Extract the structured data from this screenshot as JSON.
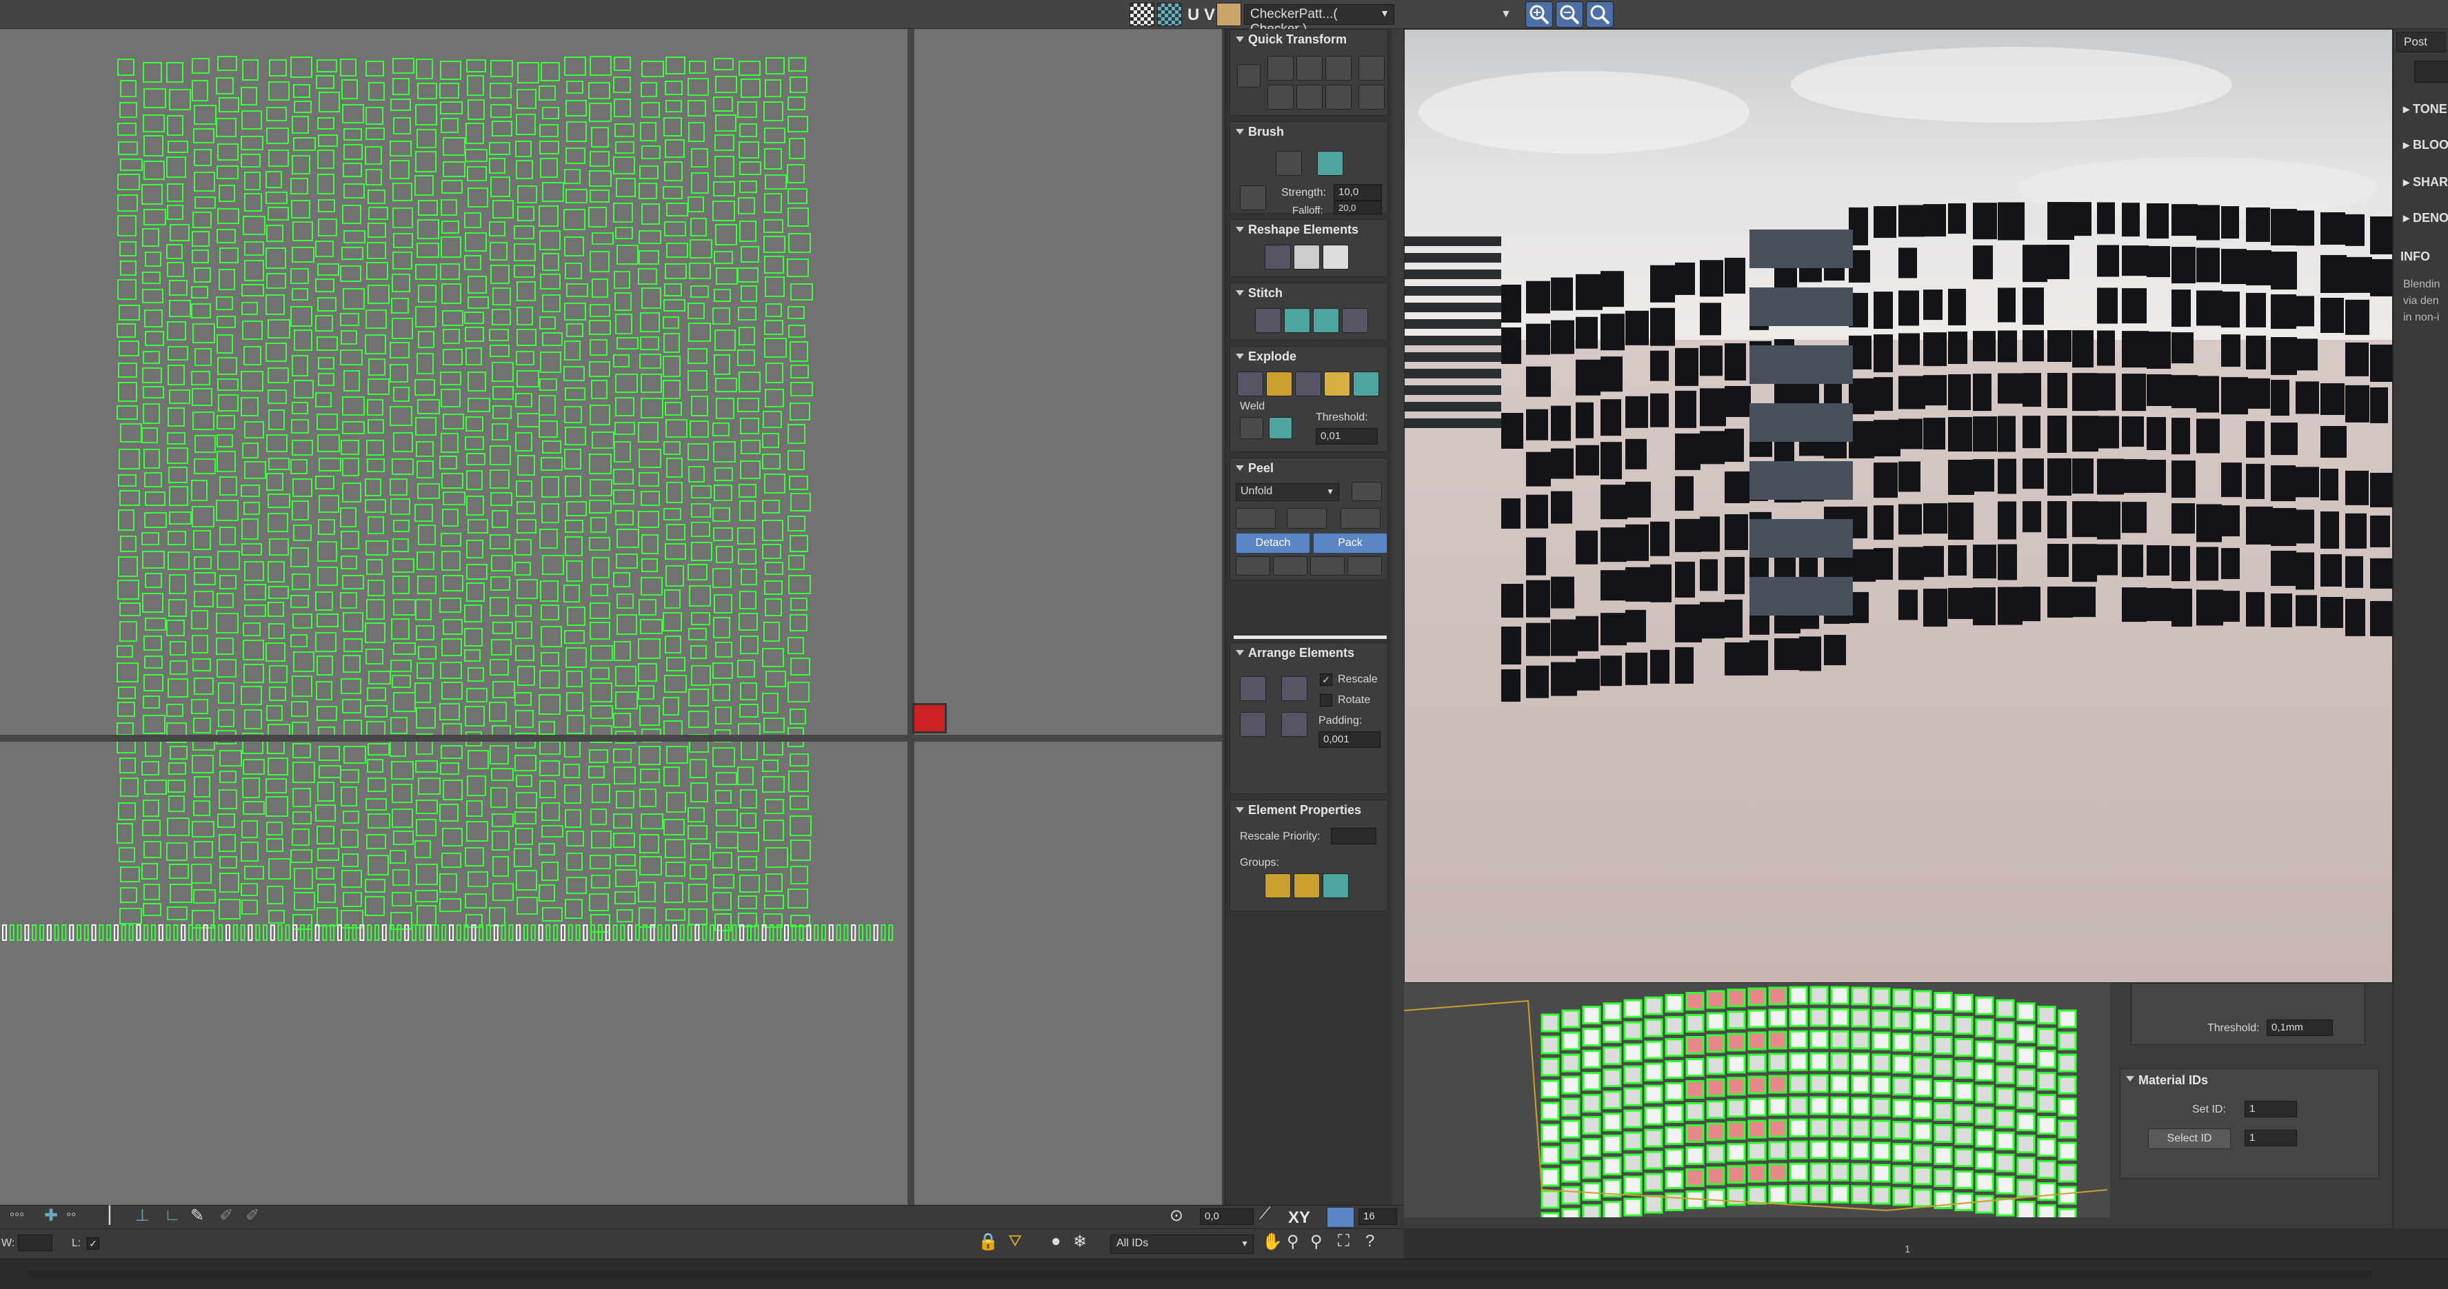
{
  "toolbar": {
    "uv_label": "U V",
    "texture_combo": "CheckerPatt...( Checker )"
  },
  "rollouts": {
    "quick_transform": "Quick Transform",
    "brush": "Brush",
    "brush_strength_label": "Strength:",
    "brush_strength": "10,0",
    "brush_falloff_label": "Falloff:",
    "brush_falloff": "20,0",
    "reshape": "Reshape Elements",
    "stitch": "Stitch",
    "explode": "Explode",
    "weld_label": "Weld",
    "threshold_label": "Threshold:",
    "threshold_value": "0,01",
    "peel": "Peel",
    "peel_mode": "Unfold",
    "detach": "Detach",
    "pack": "Pack",
    "arrange": "Arrange Elements",
    "rescale": "Rescale",
    "rotate": "Rotate",
    "padding_label": "Padding:",
    "padding_value": "0,001",
    "element_properties": "Element Properties",
    "rescale_priority": "Rescale Priority:",
    "groups": "Groups:"
  },
  "side_panel": {
    "tab": "Post",
    "items": [
      "TONE",
      "BLOO",
      "SHAR",
      "DENO"
    ],
    "info_title": "INFO",
    "info_lines": [
      "Blendin",
      "via den",
      "in non-i"
    ]
  },
  "modifier_panel": {
    "threshold_label": "Threshold:",
    "threshold_value": "0,1mm",
    "material_ids": "Material IDs",
    "set_id_label": "Set ID:",
    "set_id_value": "1",
    "select_id": "Select ID",
    "select_id_value": "1"
  },
  "bottom": {
    "angle_value": "0,0",
    "axis_label": "XY",
    "grid_value": "16",
    "ids_combo": "All IDs",
    "w_label": "W:",
    "l_label": "L:",
    "timeline_marker": "1"
  },
  "colors": {
    "uv_background": "#727272",
    "uv_wire": "#3dff3d",
    "accent_blue": "#5b86c5",
    "panel_bg": "#333333"
  }
}
